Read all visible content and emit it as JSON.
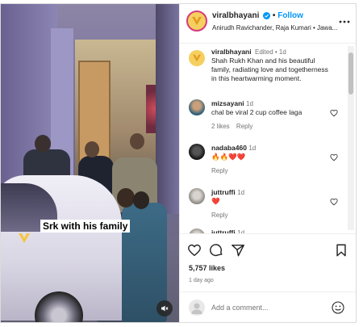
{
  "media": {
    "caption_overlay": "Srk with his family"
  },
  "header": {
    "username": "viralbhayani",
    "separator": "•",
    "follow_label": "Follow",
    "subtitle": "Anirudh Ravichander, Raja Kumari • Jawa..."
  },
  "post_caption": {
    "username": "viralbhayani",
    "edited": "Edited • 1d",
    "lines": [
      "Shah Rukh Khan and his beautiful",
      "family, radiating love and togetherness",
      "in this heartwarming moment."
    ]
  },
  "comments": [
    {
      "username": "mizsayani",
      "time": "1d",
      "text": "chal be viral 2 cup coffee laga",
      "likes": "2 likes",
      "reply": "Reply"
    },
    {
      "username": "nadaba460",
      "time": "1d",
      "text": "🔥🔥❤️❤️",
      "reply": "Reply"
    },
    {
      "username": "juttruffi",
      "time": "1d",
      "text": "❤️",
      "reply": "Reply"
    },
    {
      "username": "juttruffi",
      "time": "1d"
    }
  ],
  "actions": {
    "likes": "5,757 likes",
    "ago": "1 day ago"
  },
  "add_comment": {
    "placeholder": "Add a comment..."
  },
  "colors": {
    "follow": "#0095f6",
    "verified": "#0095f6",
    "brand": "#f5d060",
    "heart_red": "#e01f3d"
  }
}
